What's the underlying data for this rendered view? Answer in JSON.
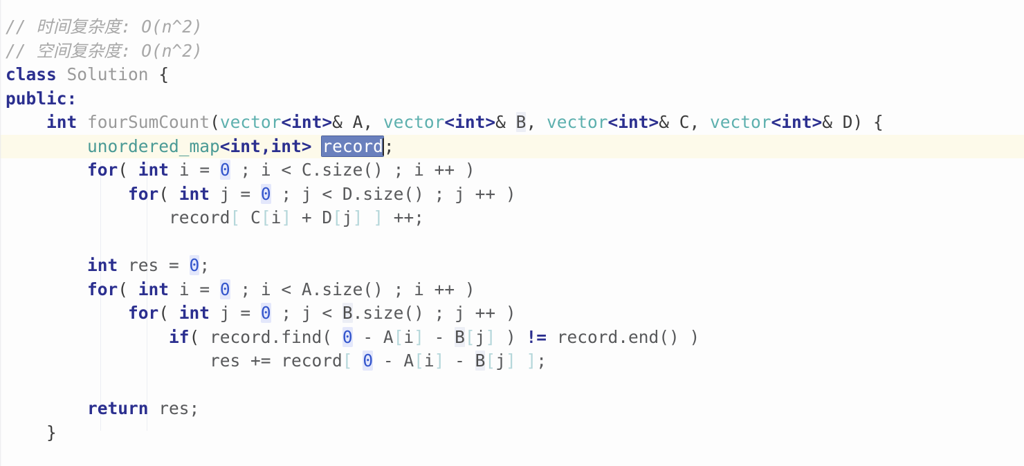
{
  "editor": {
    "language": "cpp",
    "colors": {
      "background": "#fdfdfd",
      "current_line_highlight": "#fdfaea",
      "keyword": "#2b2f8f",
      "comment": "#a8a8a8",
      "identifier": "#58595b",
      "function_name": "#9a9a9a",
      "class_type": "#5db0ae",
      "number": "#3355cc",
      "number_highlight": "#e3e7fb",
      "bracket": "#b5d7da",
      "selection_background": "#6a80bd",
      "selection_foreground": "#ffffff",
      "occurrence_highlight": "#eceef5",
      "indent_guide": "#eceef3"
    },
    "selection": {
      "text": "record",
      "line_index": 5,
      "caret_visible": true
    },
    "current_line_index": 5,
    "indent_guides": [
      145,
      212
    ],
    "lines": [
      {
        "index": 0,
        "indent": 0,
        "tokens": [
          {
            "t": "// 时间复杂度: O(n^2)",
            "c": "tok-comment"
          }
        ]
      },
      {
        "index": 1,
        "indent": 0,
        "tokens": [
          {
            "t": "// 空间复杂度: O(n^2)",
            "c": "tok-comment"
          }
        ]
      },
      {
        "index": 2,
        "indent": 0,
        "tokens": [
          {
            "t": "class",
            "c": "tok-keyword"
          },
          {
            "t": " ",
            "c": "tok-plain"
          },
          {
            "t": "Solution",
            "c": "tok-fn"
          },
          {
            "t": " ",
            "c": "tok-plain"
          },
          {
            "t": "{",
            "c": "tok-plain"
          }
        ]
      },
      {
        "index": 3,
        "indent": 0,
        "tokens": [
          {
            "t": "public",
            "c": "tok-keyword"
          },
          {
            "t": ":",
            "c": "tok-keyword"
          }
        ]
      },
      {
        "index": 4,
        "indent": 0,
        "tokens": [
          {
            "t": "    ",
            "c": "tok-plain"
          },
          {
            "t": "int",
            "c": "tok-type"
          },
          {
            "t": " ",
            "c": "tok-plain"
          },
          {
            "t": "fourSumCount",
            "c": "tok-fn"
          },
          {
            "t": "(",
            "c": "tok-plain"
          },
          {
            "t": "vector",
            "c": "tok-class"
          },
          {
            "t": "<int>",
            "c": "tok-type"
          },
          {
            "t": "& A, ",
            "c": "tok-plain"
          },
          {
            "t": "vector",
            "c": "tok-class"
          },
          {
            "t": "<int>",
            "c": "tok-type"
          },
          {
            "t": "& ",
            "c": "tok-plain"
          },
          {
            "t": "B",
            "c": "tok-occ"
          },
          {
            "t": ", ",
            "c": "tok-plain"
          },
          {
            "t": "vector",
            "c": "tok-class"
          },
          {
            "t": "<int>",
            "c": "tok-type"
          },
          {
            "t": "& C, ",
            "c": "tok-plain"
          },
          {
            "t": "vector",
            "c": "tok-class"
          },
          {
            "t": "<int>",
            "c": "tok-type"
          },
          {
            "t": "& D) {",
            "c": "tok-plain"
          }
        ]
      },
      {
        "index": 5,
        "indent": 2,
        "tokens": [
          {
            "t": "        ",
            "c": "tok-plain"
          },
          {
            "t": "unordered_map",
            "c": "tok-stl"
          },
          {
            "t": "<int,int>",
            "c": "tok-type"
          },
          {
            "t": " ",
            "c": "tok-plain"
          },
          {
            "t": "record",
            "c": "tok-selected"
          },
          {
            "t": "__CARET__",
            "c": "caret-slot"
          },
          {
            "t": ";",
            "c": "tok-plain"
          }
        ]
      },
      {
        "index": 6,
        "indent": 2,
        "tokens": [
          {
            "t": "        ",
            "c": "tok-plain"
          },
          {
            "t": "for",
            "c": "tok-keyword"
          },
          {
            "t": "( ",
            "c": "tok-plain"
          },
          {
            "t": "int",
            "c": "tok-type"
          },
          {
            "t": " i = ",
            "c": "tok-ident"
          },
          {
            "t": "0",
            "c": "tok-number"
          },
          {
            "t": " ; i < C.size() ; i ++ )",
            "c": "tok-ident"
          }
        ]
      },
      {
        "index": 7,
        "indent": 3,
        "tokens": [
          {
            "t": "            ",
            "c": "tok-plain"
          },
          {
            "t": "for",
            "c": "tok-keyword"
          },
          {
            "t": "( ",
            "c": "tok-plain"
          },
          {
            "t": "int",
            "c": "tok-type"
          },
          {
            "t": " j = ",
            "c": "tok-ident"
          },
          {
            "t": "0",
            "c": "tok-number"
          },
          {
            "t": " ; j < D.size() ; j ++ )",
            "c": "tok-ident"
          }
        ]
      },
      {
        "index": 8,
        "indent": 4,
        "tokens": [
          {
            "t": "                ",
            "c": "tok-plain"
          },
          {
            "t": "record",
            "c": "tok-ident"
          },
          {
            "t": "[",
            "c": "tok-bracket"
          },
          {
            "t": " C",
            "c": "tok-ident"
          },
          {
            "t": "[",
            "c": "tok-bracket"
          },
          {
            "t": "i",
            "c": "tok-ident"
          },
          {
            "t": "]",
            "c": "tok-bracket"
          },
          {
            "t": " + D",
            "c": "tok-ident"
          },
          {
            "t": "[",
            "c": "tok-bracket"
          },
          {
            "t": "j",
            "c": "tok-ident"
          },
          {
            "t": "]",
            "c": "tok-bracket"
          },
          {
            "t": " ",
            "c": "tok-ident"
          },
          {
            "t": "]",
            "c": "tok-bracket"
          },
          {
            "t": " ++;",
            "c": "tok-ident"
          }
        ]
      },
      {
        "index": 9,
        "indent": 2,
        "tokens": [
          {
            "t": "",
            "c": "tok-plain"
          }
        ]
      },
      {
        "index": 10,
        "indent": 2,
        "tokens": [
          {
            "t": "        ",
            "c": "tok-plain"
          },
          {
            "t": "int",
            "c": "tok-type"
          },
          {
            "t": " res = ",
            "c": "tok-ident"
          },
          {
            "t": "0",
            "c": "tok-number"
          },
          {
            "t": ";",
            "c": "tok-ident"
          }
        ]
      },
      {
        "index": 11,
        "indent": 2,
        "tokens": [
          {
            "t": "        ",
            "c": "tok-plain"
          },
          {
            "t": "for",
            "c": "tok-keyword"
          },
          {
            "t": "( ",
            "c": "tok-plain"
          },
          {
            "t": "int",
            "c": "tok-type"
          },
          {
            "t": " i = ",
            "c": "tok-ident"
          },
          {
            "t": "0",
            "c": "tok-number"
          },
          {
            "t": " ; i < A.size() ; i ++ )",
            "c": "tok-ident"
          }
        ]
      },
      {
        "index": 12,
        "indent": 3,
        "tokens": [
          {
            "t": "            ",
            "c": "tok-plain"
          },
          {
            "t": "for",
            "c": "tok-keyword"
          },
          {
            "t": "( ",
            "c": "tok-plain"
          },
          {
            "t": "int",
            "c": "tok-type"
          },
          {
            "t": " j = ",
            "c": "tok-ident"
          },
          {
            "t": "0",
            "c": "tok-number"
          },
          {
            "t": " ; j < ",
            "c": "tok-ident"
          },
          {
            "t": "B",
            "c": "tok-occ"
          },
          {
            "t": ".size() ; j ++ )",
            "c": "tok-ident"
          }
        ]
      },
      {
        "index": 13,
        "indent": 4,
        "tokens": [
          {
            "t": "                ",
            "c": "tok-plain"
          },
          {
            "t": "if",
            "c": "tok-keyword"
          },
          {
            "t": "( ",
            "c": "tok-plain"
          },
          {
            "t": "record.find( ",
            "c": "tok-ident"
          },
          {
            "t": "0",
            "c": "tok-number"
          },
          {
            "t": " - A",
            "c": "tok-ident"
          },
          {
            "t": "[",
            "c": "tok-bracket"
          },
          {
            "t": "i",
            "c": "tok-ident"
          },
          {
            "t": "]",
            "c": "tok-bracket"
          },
          {
            "t": " - ",
            "c": "tok-ident"
          },
          {
            "t": "B",
            "c": "tok-occ"
          },
          {
            "t": "[",
            "c": "tok-bracket"
          },
          {
            "t": "j",
            "c": "tok-ident"
          },
          {
            "t": "]",
            "c": "tok-bracket"
          },
          {
            "t": " ) ",
            "c": "tok-ident"
          },
          {
            "t": "!=",
            "c": "tok-opblue"
          },
          {
            "t": " record.end() )",
            "c": "tok-ident"
          }
        ]
      },
      {
        "index": 14,
        "indent": 5,
        "tokens": [
          {
            "t": "                    ",
            "c": "tok-plain"
          },
          {
            "t": "res += record",
            "c": "tok-ident"
          },
          {
            "t": "[",
            "c": "tok-bracket"
          },
          {
            "t": " ",
            "c": "tok-ident"
          },
          {
            "t": "0",
            "c": "tok-number"
          },
          {
            "t": " - A",
            "c": "tok-ident"
          },
          {
            "t": "[",
            "c": "tok-bracket"
          },
          {
            "t": "i",
            "c": "tok-ident"
          },
          {
            "t": "]",
            "c": "tok-bracket"
          },
          {
            "t": " - ",
            "c": "tok-ident"
          },
          {
            "t": "B",
            "c": "tok-occ"
          },
          {
            "t": "[",
            "c": "tok-bracket"
          },
          {
            "t": "j",
            "c": "tok-ident"
          },
          {
            "t": "]",
            "c": "tok-bracket"
          },
          {
            "t": " ",
            "c": "tok-ident"
          },
          {
            "t": "]",
            "c": "tok-bracket"
          },
          {
            "t": ";",
            "c": "tok-ident"
          }
        ]
      },
      {
        "index": 15,
        "indent": 2,
        "tokens": [
          {
            "t": "",
            "c": "tok-plain"
          }
        ]
      },
      {
        "index": 16,
        "indent": 2,
        "tokens": [
          {
            "t": "        ",
            "c": "tok-plain"
          },
          {
            "t": "return",
            "c": "tok-keyword"
          },
          {
            "t": " res;",
            "c": "tok-ident"
          }
        ]
      },
      {
        "index": 17,
        "indent": 1,
        "tokens": [
          {
            "t": "    }",
            "c": "tok-plain"
          }
        ]
      }
    ]
  }
}
